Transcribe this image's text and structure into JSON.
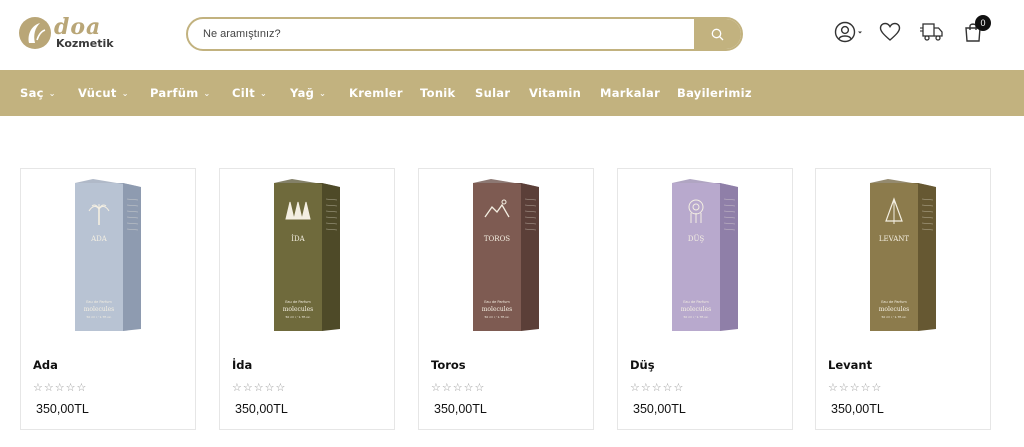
{
  "brand": {
    "name": "doa",
    "sub": "Kozmetik",
    "color": "#b9a677"
  },
  "search": {
    "placeholder": "Ne aramıştınız?"
  },
  "header_icons": [
    "user-icon",
    "heart-icon",
    "truck-icon",
    "bag-icon"
  ],
  "cart": {
    "count": "0"
  },
  "nav": {
    "items": [
      {
        "label": "Saç",
        "dropdown": true
      },
      {
        "label": "Vücut",
        "dropdown": true
      },
      {
        "label": "Parfüm",
        "dropdown": true
      },
      {
        "label": "Cilt",
        "dropdown": true
      },
      {
        "label": "Yağ",
        "dropdown": true
      },
      {
        "label": "Kremler",
        "dropdown": false
      },
      {
        "label": "Tonik",
        "dropdown": false
      },
      {
        "label": "Sular",
        "dropdown": false
      },
      {
        "label": "Vitamin",
        "dropdown": false
      },
      {
        "label": "Markalar",
        "dropdown": false
      },
      {
        "label": "Bayilerimiz",
        "dropdown": false
      }
    ],
    "caret": "⌄",
    "bg_color": "#c2b27f"
  },
  "products": [
    {
      "name": "Ada",
      "box_label": "ADA",
      "box_color": "#b8c3d3",
      "box_dark": "#8e9bb0",
      "emblem": "palm",
      "stars": "☆☆☆☆☆",
      "rating": 0,
      "price": "350,00TL"
    },
    {
      "name": "İda",
      "box_label": "İDA",
      "box_color": "#6f6a3c",
      "box_dark": "#4e4a28",
      "emblem": "trees",
      "stars": "☆☆☆☆☆",
      "rating": 0,
      "price": "350,00TL"
    },
    {
      "name": "Toros",
      "box_label": "TOROS",
      "box_color": "#7e5b52",
      "box_dark": "#5b3f38",
      "emblem": "mountain",
      "stars": "☆☆☆☆☆",
      "rating": 0,
      "price": "350,00TL"
    },
    {
      "name": "Düş",
      "box_label": "DÜŞ",
      "box_color": "#b8a9cd",
      "box_dark": "#8f7fa8",
      "emblem": "dreamcatcher",
      "stars": "☆☆☆☆☆",
      "rating": 0,
      "price": "350,00TL"
    },
    {
      "name": "Levant",
      "box_label": "LEVANT",
      "box_color": "#8c7b4c",
      "box_dark": "#665832",
      "emblem": "cedar",
      "stars": "☆☆☆☆☆",
      "rating": 0,
      "price": "350,00TL"
    }
  ],
  "box_text": {
    "line1": "Eau de Parfum",
    "line2": "molecules",
    "line3": "50 ml ℮ 1.7fl.oz."
  }
}
